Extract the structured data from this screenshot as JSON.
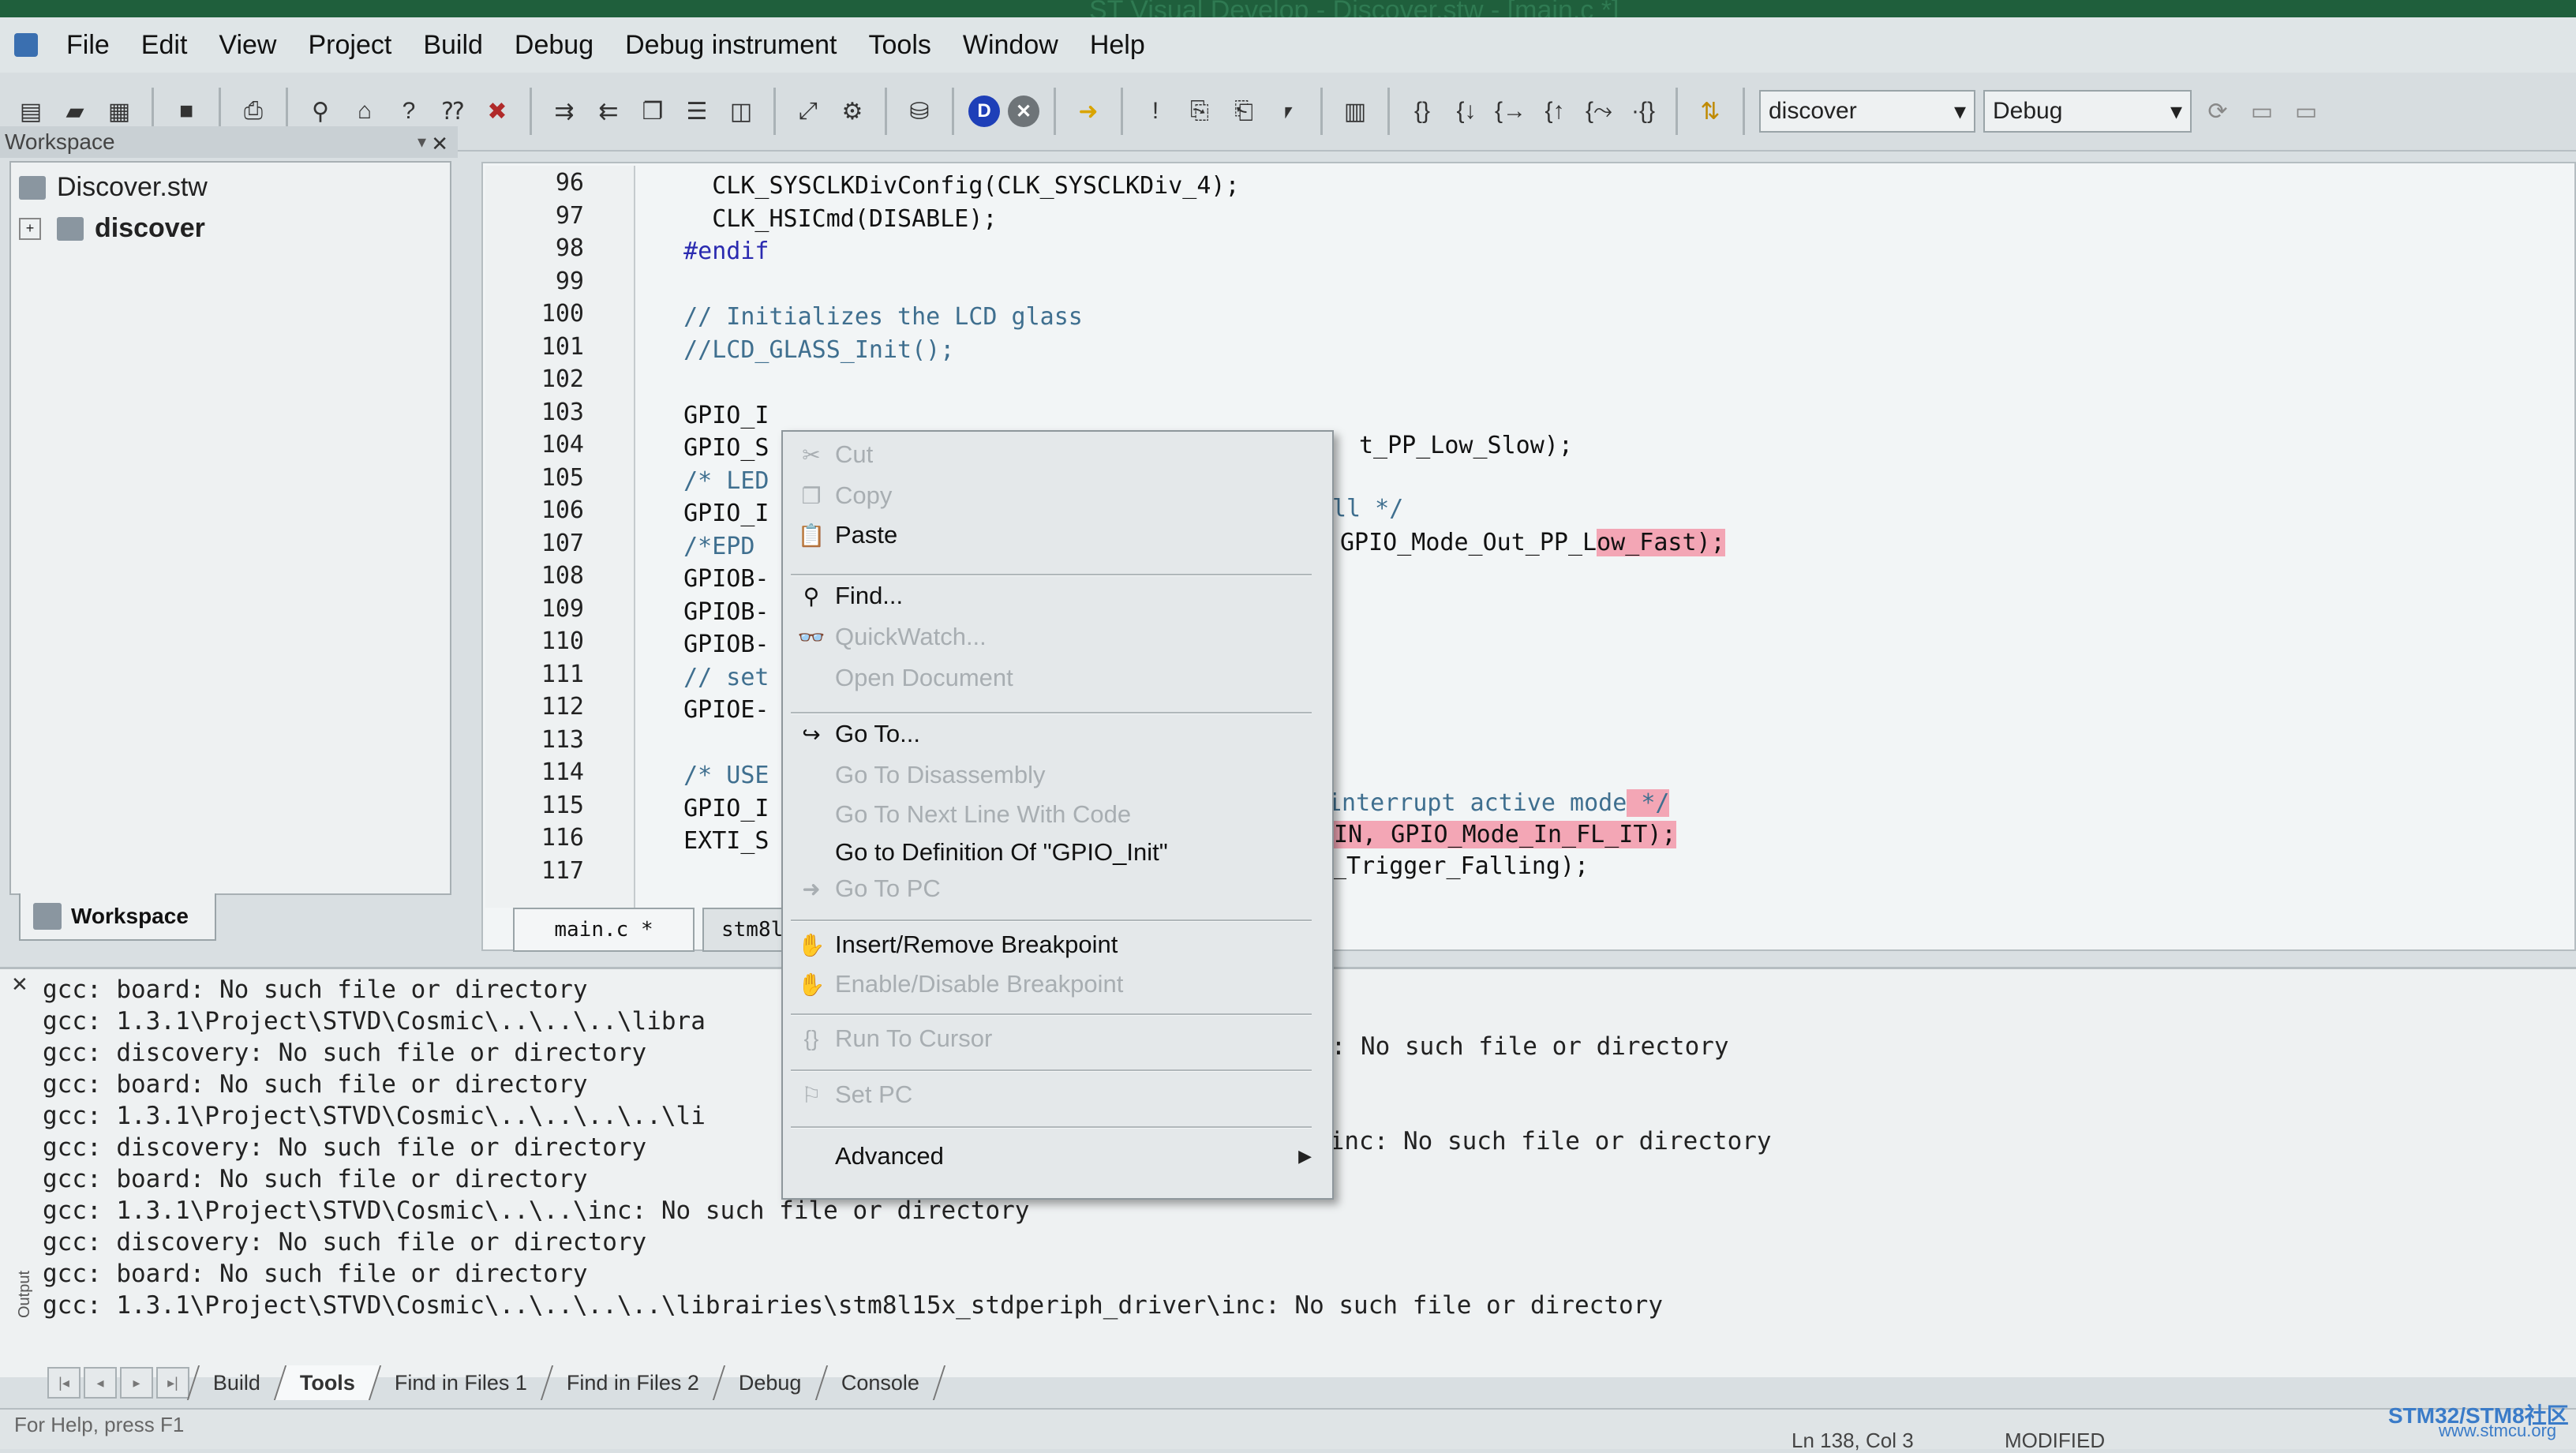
{
  "window": {
    "title": "ST Visual Develop - Discover.stw - [main.c *]"
  },
  "menu": [
    "File",
    "Edit",
    "View",
    "Project",
    "Build",
    "Debug",
    "Debug instrument",
    "Tools",
    "Window",
    "Help"
  ],
  "toolbar": {
    "project_combo": "discover",
    "config_combo": "Debug",
    "icons": [
      "new-file-icon",
      "open-file-icon",
      "open-workspace-icon",
      "save-icon",
      "print-icon",
      "find-icon",
      "home-icon",
      "help-icon",
      "context-help-icon",
      "stop-help-icon",
      "compile-icon",
      "build-icon",
      "rebuild-icon",
      "split-horizontal-icon",
      "split-vertical-icon",
      "tool-icon",
      "settings-icon",
      "debug-start-icon",
      "debug-stop-icon",
      "run-icon",
      "breakpoint-icon",
      "step-icon"
    ]
  },
  "workspace": {
    "header": "Workspace",
    "items": [
      {
        "label": "Discover.stw"
      },
      {
        "label": "discover"
      }
    ],
    "tab": "Workspace"
  },
  "editor": {
    "lines": [
      {
        "num": "96",
        "text": "    CLK_SYSCLKDivConfig(CLK_SYSCLKDiv_4);"
      },
      {
        "num": "97",
        "text": "    CLK_HSICmd(DISABLE);"
      },
      {
        "num": "98",
        "text": "  #endif"
      },
      {
        "num": "99",
        "text": ""
      },
      {
        "num": "100",
        "text": "  // Initializes the LCD glass"
      },
      {
        "num": "101",
        "text": "  //LCD_GLASS_Init();"
      },
      {
        "num": "102",
        "text": ""
      },
      {
        "num": "103",
        "text": "  GPIO_I"
      },
      {
        "num": "104",
        "text": "  GPIO_S"
      },
      {
        "num": "105",
        "text": "  /* LED"
      },
      {
        "num": "106",
        "text": "  GPIO_I"
      },
      {
        "num": "107",
        "text": "  /*EPD"
      },
      {
        "num": "108",
        "text": "  GPIOB-"
      },
      {
        "num": "109",
        "text": "  GPIOB-"
      },
      {
        "num": "110",
        "text": "  GPIOB-"
      },
      {
        "num": "111",
        "text": "  // set"
      },
      {
        "num": "112",
        "text": "  GPIOE-"
      },
      {
        "num": "113",
        "text": ""
      },
      {
        "num": "114",
        "text": "  /* USE"
      },
      {
        "num": "115",
        "text": "  GPIO_I"
      },
      {
        "num": "116",
        "text": "  EXTI_S"
      },
      {
        "num": "117",
        "text": ""
      }
    ],
    "frag_103": "t_PP_Low_Slow);",
    "frag_105": "ll */",
    "frag_106a": "GPIO_Mode_Out_PP_L",
    "frag_106b": "ow_Fast);",
    "frag_114a": "interrupt active mode",
    "frag_114b": " */",
    "frag_115a": "PIN, GPIO_Mode_In_FL_IT);",
    "frag_116": "_Trigger_Falling);",
    "tabs": [
      "main.c *",
      "stm8l"
    ]
  },
  "context_menu": {
    "items": [
      {
        "label": "Cut",
        "enabled": false,
        "icon": "cut-icon"
      },
      {
        "label": "Copy",
        "enabled": false,
        "icon": "copy-icon"
      },
      {
        "label": "Paste",
        "enabled": true,
        "icon": "paste-icon"
      },
      {
        "label": "Find...",
        "enabled": true,
        "icon": "find-icon"
      },
      {
        "label": "QuickWatch...",
        "enabled": false,
        "icon": "quickwatch-icon"
      },
      {
        "label": "Open Document",
        "enabled": false,
        "icon": ""
      },
      {
        "label": "Go To...",
        "enabled": true,
        "icon": "goto-icon"
      },
      {
        "label": "Go To Disassembly",
        "enabled": false,
        "icon": ""
      },
      {
        "label": "Go To Next Line With Code",
        "enabled": false,
        "icon": ""
      },
      {
        "label": "Go to Definition Of \"GPIO_Init\"",
        "enabled": true,
        "icon": ""
      },
      {
        "label": "Go To PC",
        "enabled": false,
        "icon": "arrow-right-icon"
      },
      {
        "label": "Insert/Remove Breakpoint",
        "enabled": true,
        "icon": "hand-breakpoint-icon"
      },
      {
        "label": "Enable/Disable Breakpoint",
        "enabled": false,
        "icon": "breakpoint-toggle-icon"
      },
      {
        "label": "Run To Cursor",
        "enabled": false,
        "icon": "run-to-cursor-icon"
      },
      {
        "label": "Set PC",
        "enabled": false,
        "icon": "set-pc-icon"
      },
      {
        "label": "Advanced",
        "enabled": true,
        "icon": "",
        "submenu": true
      }
    ]
  },
  "output": {
    "lines": [
      "gcc: board: No such file or directory",
      "gcc: 1.3.1\\Project\\STVD\\Cosmic\\..\\..\\..\\libra",
      "gcc: discovery: No such file or directory",
      "gcc: board: No such file or directory",
      "gcc: 1.3.1\\Project\\STVD\\Cosmic\\..\\..\\..\\..\\li",
      "gcc: discovery: No such file or directory",
      "gcc: board: No such file or directory",
      "gcc: 1.3.1\\Project\\STVD\\Cosmic\\..\\..\\inc: No such file or directory",
      "gcc: discovery: No such file or directory",
      "gcc: board: No such file or directory",
      "gcc: 1.3.1\\Project\\STVD\\Cosmic\\..\\..\\..\\..\\librairies\\stm8l15x_stdperiph_driver\\inc: No such file or directory"
    ],
    "right_frag_1": "c: No such file or directory",
    "right_frag_2": "\\inc: No such file or directory",
    "side_label": "Output",
    "tabs": [
      "Build",
      "Tools",
      "Find in Files 1",
      "Find in Files 2",
      "Debug",
      "Console"
    ],
    "active_tab": "Tools"
  },
  "status": {
    "help": "For Help, press F1",
    "position": "Ln 138, Col 3",
    "modified": "MODIFIED"
  },
  "watermark": {
    "line1": "STM32/STM8社区",
    "line2": "www.stmcu.org"
  }
}
